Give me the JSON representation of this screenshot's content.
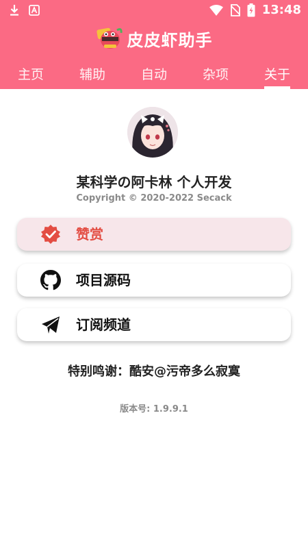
{
  "status_bar": {
    "time": "13:48",
    "icons": [
      "download-icon",
      "a-box-icon",
      "wifi-icon",
      "no-sim-icon",
      "battery-charging-icon"
    ]
  },
  "app": {
    "title": "皮皮虾助手",
    "icon": "shrimp-mascot-icon",
    "accent_color": "#fb6a84"
  },
  "tabs": [
    {
      "label": "主页",
      "active": false
    },
    {
      "label": "辅助",
      "active": false
    },
    {
      "label": "自动",
      "active": false
    },
    {
      "label": "杂项",
      "active": false
    },
    {
      "label": "关于",
      "active": true
    }
  ],
  "about": {
    "developer": "某科学の阿卡林 个人开发",
    "copyright": "Copyright © 2020-2022 Secack",
    "buttons": [
      {
        "label": "赞赏",
        "icon": "verified-badge-icon",
        "highlighted": true
      },
      {
        "label": "项目源码",
        "icon": "github-icon",
        "highlighted": false
      },
      {
        "label": "订阅频道",
        "icon": "telegram-send-icon",
        "highlighted": false
      }
    ],
    "thanks": "特别鸣谢：酷安@污帝多么寂寞",
    "version": "版本号: 1.9.9.1"
  }
}
